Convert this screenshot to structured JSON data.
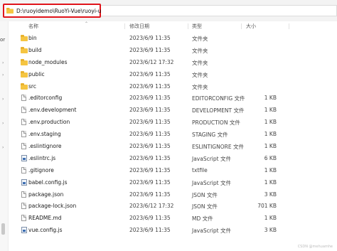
{
  "address": {
    "path": "D:\\ruoyidemo\\RuoYi-Vue\\ruoyi-ui"
  },
  "nav": {
    "label": "or"
  },
  "columns": {
    "name": "名称",
    "modified": "修改日期",
    "type": "类型",
    "size": "大小"
  },
  "files": [
    {
      "name": "bin",
      "modified": "2023/6/9 11:35",
      "type": "文件夹",
      "size": "",
      "icon": "folder-icon"
    },
    {
      "name": "build",
      "modified": "2023/6/9 11:35",
      "type": "文件夹",
      "size": "",
      "icon": "folder-icon"
    },
    {
      "name": "node_modules",
      "modified": "2023/6/12 17:32",
      "type": "文件夹",
      "size": "",
      "icon": "folder-icon"
    },
    {
      "name": "public",
      "modified": "2023/6/9 11:35",
      "type": "文件夹",
      "size": "",
      "icon": "folder-icon"
    },
    {
      "name": "src",
      "modified": "2023/6/9 11:35",
      "type": "文件夹",
      "size": "",
      "icon": "folder-icon"
    },
    {
      "name": ".editorconfig",
      "modified": "2023/6/9 11:35",
      "type": "EDITORCONFIG 文件",
      "size": "1 KB",
      "icon": "file-icon"
    },
    {
      "name": ".env.development",
      "modified": "2023/6/9 11:35",
      "type": "DEVELOPMENT 文件",
      "size": "1 KB",
      "icon": "file-icon"
    },
    {
      "name": ".env.production",
      "modified": "2023/6/9 11:35",
      "type": "PRODUCTION 文件",
      "size": "1 KB",
      "icon": "file-icon"
    },
    {
      "name": ".env.staging",
      "modified": "2023/6/9 11:35",
      "type": "STAGING 文件",
      "size": "1 KB",
      "icon": "file-icon"
    },
    {
      "name": ".eslintignore",
      "modified": "2023/6/9 11:35",
      "type": "ESLINTIGNORE 文件",
      "size": "1 KB",
      "icon": "file-icon"
    },
    {
      "name": ".eslintrc.js",
      "modified": "2023/6/9 11:35",
      "type": "JavaScript 文件",
      "size": "6 KB",
      "icon": "js-file-icon"
    },
    {
      "name": ".gitignore",
      "modified": "2023/6/9 11:35",
      "type": "txtfile",
      "size": "1 KB",
      "icon": "file-icon"
    },
    {
      "name": "babel.config.js",
      "modified": "2023/6/9 11:35",
      "type": "JavaScript 文件",
      "size": "1 KB",
      "icon": "js-file-icon"
    },
    {
      "name": "package.json",
      "modified": "2023/6/9 11:35",
      "type": "JSON 文件",
      "size": "3 KB",
      "icon": "file-icon"
    },
    {
      "name": "package-lock.json",
      "modified": "2023/6/12 17:32",
      "type": "JSON 文件",
      "size": "701 KB",
      "icon": "file-icon"
    },
    {
      "name": "README.md",
      "modified": "2023/6/9 11:35",
      "type": "MD 文件",
      "size": "1 KB",
      "icon": "file-icon"
    },
    {
      "name": "vue.config.js",
      "modified": "2023/6/9 11:35",
      "type": "JavaScript 文件",
      "size": "3 KB",
      "icon": "js-file-icon"
    }
  ],
  "watermark": "CSDN @mehuamhe",
  "colors": {
    "highlight": "#e0141b",
    "folder": "#f5c542"
  }
}
